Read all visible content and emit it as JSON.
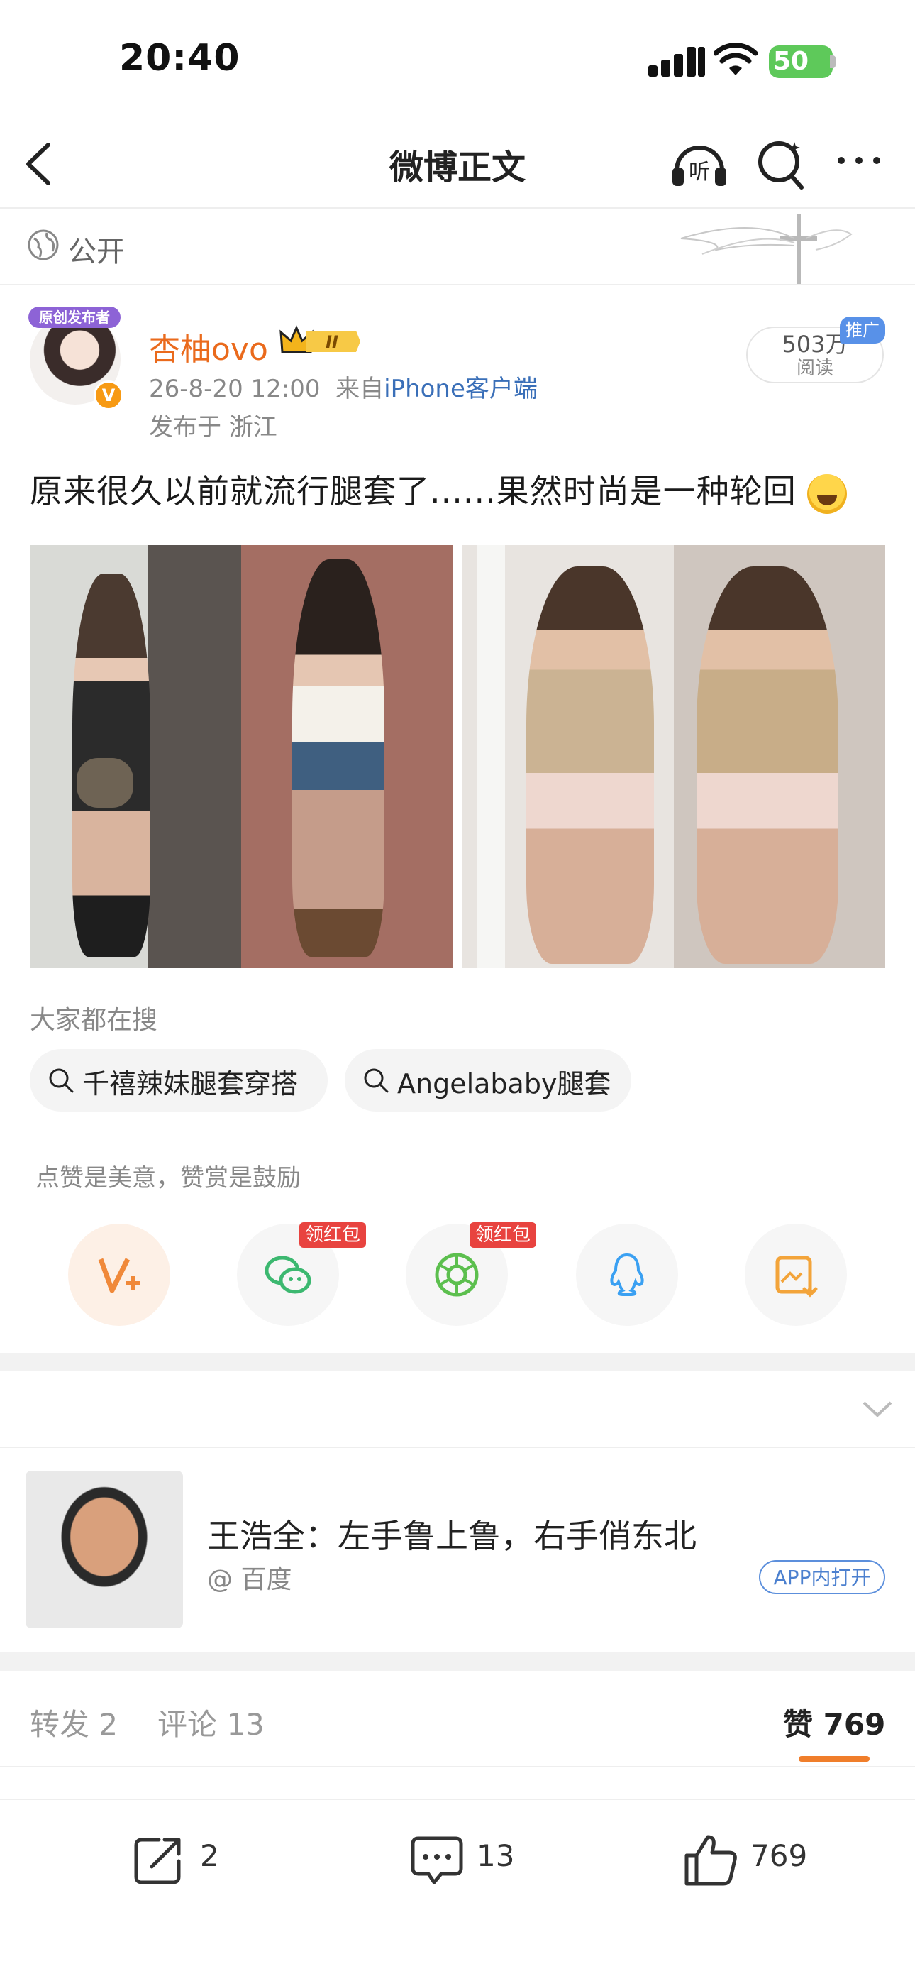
{
  "status_bar": {
    "time": "20:40",
    "battery": "50"
  },
  "nav": {
    "title": "微博正文",
    "listen_label": "听"
  },
  "visibility": {
    "label": "公开"
  },
  "author": {
    "avatar_badge": "原创发布者",
    "name": "杏柚ovo",
    "level_badge": "II",
    "timestamp": "26-8-20 12:00",
    "source_prefix": "来自",
    "source": "iPhone客户端",
    "location": "发布于 浙江"
  },
  "reads": {
    "count": "503万",
    "label": "阅读",
    "promo": "推广"
  },
  "post": {
    "text": "原来很久以前就流行腿套了......果然时尚是一种轮回"
  },
  "searches": {
    "heading": "大家都在搜",
    "items": [
      "千禧辣妹腿套穿搭",
      "Angelababy腿套"
    ]
  },
  "praise": {
    "hint": "点赞是美意，赞赏是鼓励",
    "redpack_label": "领红包",
    "buttons": [
      "reward",
      "wechat",
      "moments",
      "qq",
      "save-image"
    ]
  },
  "card": {
    "title": "王浩全：左手鲁上鲁，右手俏东北",
    "source": "@ 百度",
    "action": "APP内打开"
  },
  "tabs": {
    "repost": "转发 2",
    "comment": "评论 13",
    "like": "赞 769"
  },
  "bottom_bar": {
    "repost_count": "2",
    "comment_count": "13",
    "like_count": "769"
  },
  "colors": {
    "accent": "#ea6a1c",
    "link": "#3a6fb8",
    "redpack": "#e8433f",
    "underline": "#f07e2b"
  }
}
